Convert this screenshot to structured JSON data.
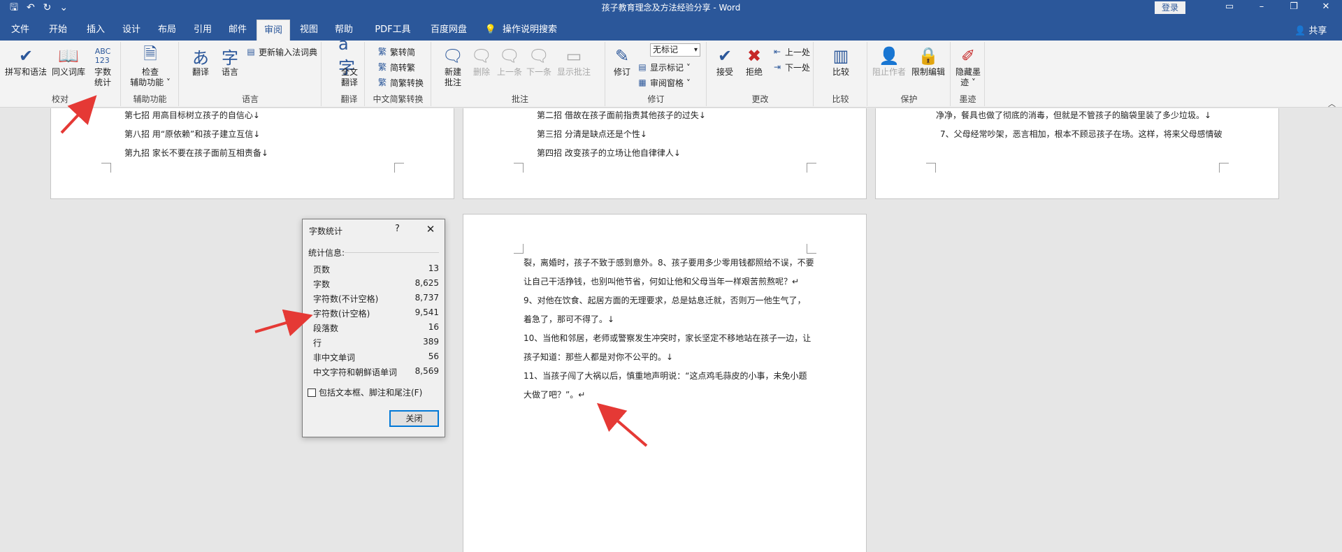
{
  "titlebar": {
    "title": "孩子教育理念及方法经验分享  -  Word",
    "signin": "登录",
    "qat_icons": [
      "save-icon",
      "undo-icon",
      "redo-icon",
      "customize-icon"
    ],
    "qat_glyphs": [
      "🖫",
      "↶",
      "↻",
      "⌄"
    ]
  },
  "tabs": {
    "items": [
      "文件",
      "开始",
      "插入",
      "设计",
      "布局",
      "引用",
      "邮件",
      "审阅",
      "视图",
      "帮助",
      "PDF工具集",
      "百度网盘",
      "操作说明搜索"
    ],
    "active": "审阅",
    "share": "共享"
  },
  "ribbon": {
    "groups": {
      "proofing": "校对",
      "accessibility": "辅助功能",
      "language": "语言",
      "translate": "翻译",
      "chinese_conv": "中文简繁转换",
      "comments": "批注",
      "tracking": "修订",
      "changes": "更改",
      "compare": "比较",
      "protect": "保护",
      "ink": "墨迹"
    },
    "buttons": {
      "spelling": "拼写和语法",
      "thesaurus": "同义词库",
      "wordcount_1": "字数",
      "wordcount_2": "统计",
      "check_1": "检查",
      "check_2": "辅助功能 ˅",
      "translate": "翻译",
      "language": "语言",
      "update_ime": "更新输入法词典",
      "fulltrans_1": "全文",
      "fulltrans_2": "翻译",
      "trad_simp": "繁转简",
      "simp_trad": "简转繁",
      "conv": "简繁转换",
      "newcomment_1": "新建",
      "newcomment_2": "批注",
      "delete": "删除",
      "prev": "上一条",
      "next": "下一条",
      "show_comments": "显示批注",
      "track": "修订",
      "markup_combo": "无标记",
      "show_markup": "显示标记 ˅",
      "review_pane": "审阅窗格 ˅",
      "accept": "接受",
      "reject": "拒绝",
      "prev_change": "上一处",
      "next_change": "下一处",
      "compare": "比较",
      "block_authors": "阻止作者",
      "restrict": "限制编辑",
      "hide_ink_1": "隐藏墨",
      "hide_ink_2": "迹 ˅"
    }
  },
  "pages": {
    "p1": [
      "第七招     用高目标树立孩子的自信心↓",
      "第八招     用“原依赖”和孩子建立互信↓",
      "第九招     家长不要在孩子面前互相责备↓"
    ],
    "p2": [
      "第二招  借故在孩子面前指责其他孩子的过失↓",
      "第三招  分清是缺点还是个性↓",
      "第四招  改变孩子的立场让他自律律人↓"
    ],
    "p3": [
      "净净，餐具也做了彻底的消毒，但就是不管孩子的脑袋里装了多少垃圾。↓",
      "7、父母经常吵架，恶言相加，根本不顾忌孩子在场。这样，将来父母感情破"
    ],
    "p4": [
      "裂，离婚时，孩子不致于感到意外。8、孩子要用多少零用钱都照给不误，不要",
      "让自己干活挣钱，也别叫他节省，何如让他和父母当年一样艰苦煎熬呢？↵",
      "  9、对他在饮食、起居方面的无理要求，总是姑息迁就，否则万一他生气了，",
      "着急了，那可不得了。↓",
      "  10、当他和邻居，老师或警察发生冲突时，家长坚定不移地站在孩子一边，让",
      "孩子知道：那些人都是对你不公平的。↓",
      "  11、当孩子闯了大祸以后，慎重地声明说：“这点鸡毛蒜皮的小事，未免小题",
      "大做了吧？”。↵"
    ]
  },
  "dialog": {
    "title": "字数统计",
    "help": "?",
    "section": "统计信息:",
    "stats": [
      {
        "label": "页数",
        "value": "13"
      },
      {
        "label": "字数",
        "value": "8,625"
      },
      {
        "label": "字符数(不计空格)",
        "value": "8,737"
      },
      {
        "label": "字符数(计空格)",
        "value": "9,541"
      },
      {
        "label": "段落数",
        "value": "16"
      },
      {
        "label": "行",
        "value": "389"
      },
      {
        "label": "非中文单词",
        "value": "56"
      },
      {
        "label": "中文字符和朝鲜语单词",
        "value": "8,569"
      }
    ],
    "checkbox": "包括文本框、脚注和尾注(F)",
    "close_button": "关闭"
  },
  "colors": {
    "word_blue": "#2b579a",
    "arrow_red": "#e53935",
    "dialog_button_border": "#0078d7"
  }
}
